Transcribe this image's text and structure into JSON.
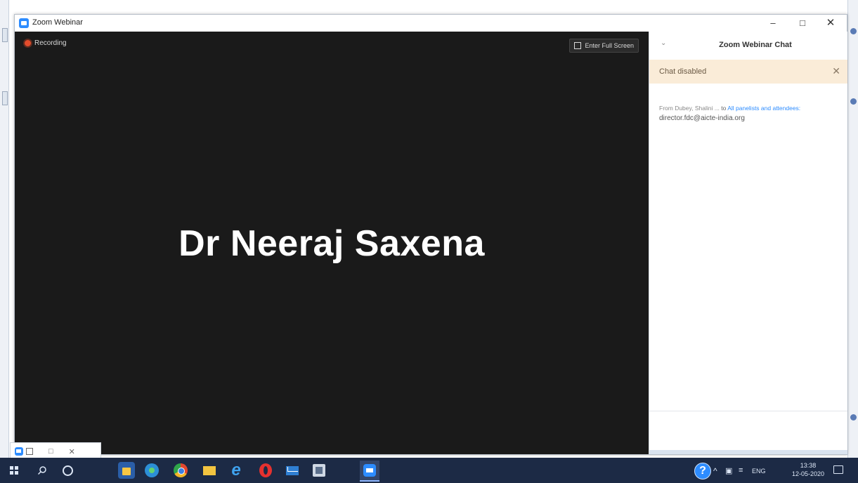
{
  "window": {
    "title": "Zoom Webinar",
    "minimize_glyph": "–",
    "maximize_glyph": "□",
    "close_glyph": "✕"
  },
  "video": {
    "recording_label": "Recording",
    "fullscreen_label": "Enter Full Screen",
    "speaker_name": "Dr Neeraj Saxena"
  },
  "chat": {
    "title": "Zoom Webinar Chat",
    "chevron_glyph": "⌄",
    "banner_text": "Chat disabled",
    "banner_close": "✕",
    "message": {
      "from": "From Dubey, Shalini ...",
      "to_word": "to",
      "recipients": "All panelists and attendees:",
      "text": "director.fdc@aicte-india.org"
    }
  },
  "mini_window": {
    "restore_glyph": "□",
    "close_glyph": "✕"
  },
  "taskbar": {
    "help_glyph": "?",
    "tray_caret": "^",
    "network_glyph": "▣",
    "volume_glyph": "≡",
    "language": "ENG",
    "time": "13:38",
    "date": "12-05-2020",
    "ie_glyph": "e"
  },
  "colors": {
    "zoom_blue": "#2d8cff",
    "video_bg": "#1a1a1a",
    "banner_bg": "#faecd8",
    "taskbar_bg": "#1c2a45",
    "recording_red": "#e24c2c"
  },
  "icons": [
    "zoom-app-icon",
    "recording-dot-icon",
    "fullscreen-icon",
    "chevron-down-icon",
    "close-icon",
    "windows-start-icon",
    "search-icon",
    "cortana-icon",
    "store-icon",
    "edge-icon",
    "chrome-icon",
    "file-explorer-icon",
    "internet-explorer-icon",
    "opera-icon",
    "mail-icon",
    "photos-icon",
    "zoom-taskbar-icon",
    "help-icon",
    "notification-icon"
  ]
}
